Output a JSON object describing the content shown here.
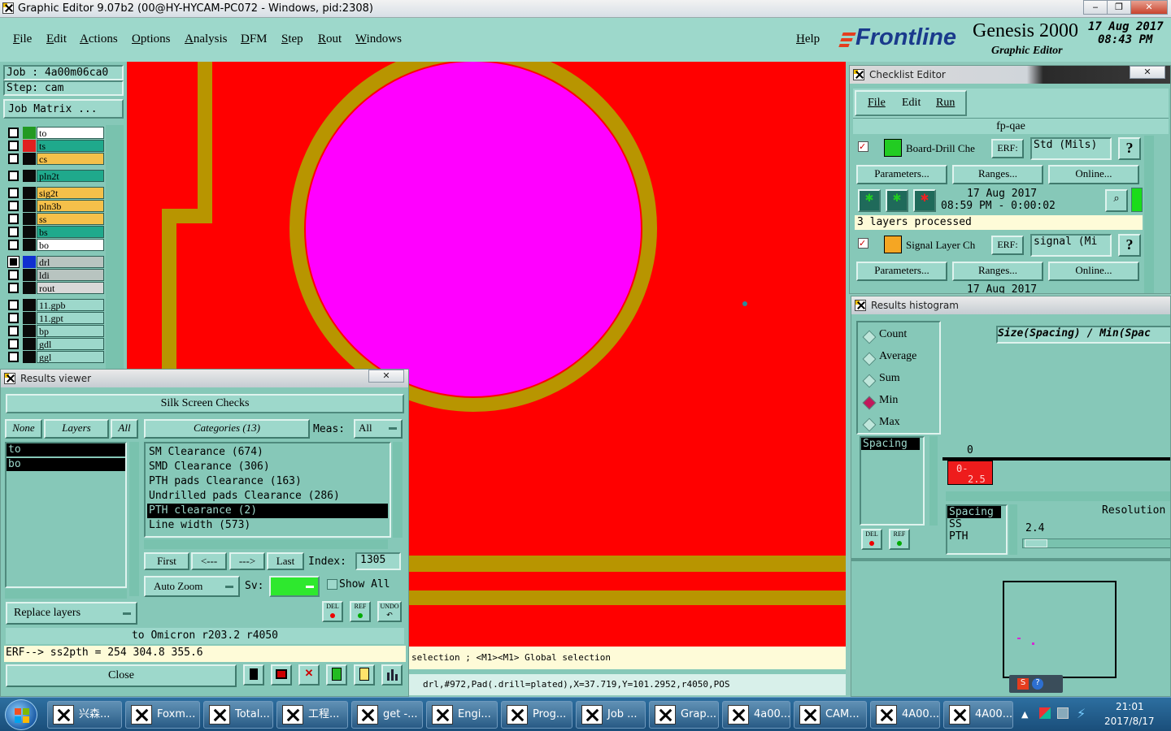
{
  "window": {
    "title": "Graphic Editor 9.07b2 (00@HY-HYCAM-PC072 - Windows, pid:2308)",
    "min": "‒",
    "max": "❐",
    "close": "✕"
  },
  "menu": {
    "items": [
      "File",
      "Edit",
      "Actions",
      "Options",
      "Analysis",
      "DFM",
      "Step",
      "Rout",
      "Windows"
    ],
    "help": "Help"
  },
  "brand": {
    "logo": "Frontline",
    "product": "Genesis 2000",
    "subtitle": "Graphic Editor",
    "date": "17 Aug 2017",
    "time": "08:43  PM"
  },
  "job": {
    "job_line": "Job  : 4a00m06ca0",
    "step_line": "Step: cam",
    "matrix_button": "Job Matrix ..."
  },
  "layers": [
    {
      "name": "to",
      "color": "#ffffff",
      "swatch": "#229922"
    },
    {
      "name": "ts",
      "color": "#1fa98c",
      "swatch": "#e02020"
    },
    {
      "name": "cs",
      "color": "#f5c04a",
      "swatch": "#0a0a0a"
    },
    {
      "name": "pln2t",
      "color": "#1fa98c",
      "swatch": "#0a0a0a"
    },
    {
      "name": "sig2t",
      "color": "#f5c04a",
      "swatch": "#0a0a0a"
    },
    {
      "name": "pln3b",
      "color": "#f5c04a",
      "swatch": "#0a0a0a"
    },
    {
      "name": "ss",
      "color": "#f5c04a",
      "swatch": "#0a0a0a"
    },
    {
      "name": "bs",
      "color": "#1fa98c",
      "swatch": "#0a0a0a"
    },
    {
      "name": "bo",
      "color": "#ffffff",
      "swatch": "#0a0a0a"
    },
    {
      "name": "drl",
      "color": "#b8c4c0",
      "swatch": "#1030d0"
    },
    {
      "name": "ldi",
      "color": "#b8c4c0",
      "swatch": "#0a0a0a"
    },
    {
      "name": "rout",
      "color": "#d8d8d8",
      "swatch": "#0a0a0a"
    },
    {
      "name": "11.gpb",
      "color": "#9dd8cb",
      "swatch": "#0a0a0a"
    },
    {
      "name": "11.gpt",
      "color": "#9dd8cb",
      "swatch": "#0a0a0a"
    },
    {
      "name": "bp",
      "color": "#9dd8cb",
      "swatch": "#0a0a0a"
    },
    {
      "name": "gdl",
      "color": "#9dd8cb",
      "swatch": "#0a0a0a"
    },
    {
      "name": "ggl",
      "color": "#9dd8cb",
      "swatch": "#0a0a0a"
    }
  ],
  "status": {
    "mouse_hint": "selection ; <M1><M1> Global selection",
    "info": "drl,#972,Pad(.drill=plated),X=37.719,Y=101.2952,r4050,POS"
  },
  "results_viewer": {
    "title": "Results viewer",
    "close": "✕",
    "header": "Silk Screen Checks",
    "none": "None",
    "layers_label": "Layers",
    "all": "All",
    "layer_items": [
      "to",
      "bo"
    ],
    "categories_label": "Categories (13)",
    "meas_label": "Meas:",
    "meas_value": "All",
    "categories": [
      "SM Clearance (674)",
      "SMD Clearance (306)",
      "PTH pads Clearance (163)",
      "Undrilled pads Clearance (286)",
      "PTH clearance (2)",
      "Line width (573)"
    ],
    "first": "First",
    "prev": "<---",
    "next": "--->",
    "last": "Last",
    "index_label": "Index:",
    "index_value": "1305",
    "auto_zoom": "Auto Zoom",
    "sv_label": "Sv:",
    "show_all": "Show All",
    "del": "DEL",
    "ref": "REF",
    "undo": "UNDO",
    "replace_layers": "Replace layers",
    "info_line": "to Omicron  r203.2  r4050",
    "erf_line": "ERF--> ss2pth = 254 304.8 355.6",
    "close_button": "Close"
  },
  "checklist": {
    "title": "Checklist Editor",
    "close": "✕",
    "menu": [
      "File",
      "Edit",
      "Run"
    ],
    "name": "fp-qae",
    "checks": [
      {
        "name": "Board-Drill Che",
        "erf": "ERF:",
        "erf_value": "Std (Mils)",
        "help": "?",
        "params": "Parameters...",
        "ranges": "Ranges...",
        "online": "Online...",
        "date": "17 Aug 2017",
        "time": "08:59 PM - 0:00:02",
        "status": "3 layers processed"
      },
      {
        "name": "Signal Layer Ch",
        "erf": "ERF:",
        "erf_value": "signal (Mi",
        "help": "?",
        "params": "Parameters...",
        "ranges": "Ranges...",
        "online": "Online...",
        "date": "17 Aug 2017"
      }
    ]
  },
  "histogram": {
    "title": "Results histogram",
    "modes": [
      "Count",
      "Average",
      "Sum",
      "Min",
      "Max"
    ],
    "selected_mode": "Min",
    "heading": "Size(Spacing) / Min(Spac",
    "zero": "0",
    "bar_label_top": "0-",
    "bar_label_bottom": "2.5",
    "list_top": [
      "Spacing"
    ],
    "list_bottom": [
      "Spacing",
      "SS",
      "PTH"
    ],
    "resolution_label": "Resolution",
    "resolution_value": "2.4",
    "del": "DEL",
    "ref": "REF"
  },
  "taskbar": {
    "items": [
      "兴森...",
      "Foxm...",
      "Total...",
      "工程...",
      "get -...",
      "Engi...",
      "Prog...",
      "Job ...",
      "Grap...",
      "4a00...",
      "CAM...",
      "4A00...",
      "4A00..."
    ],
    "time": "21:01",
    "date": "2017/8/17"
  }
}
